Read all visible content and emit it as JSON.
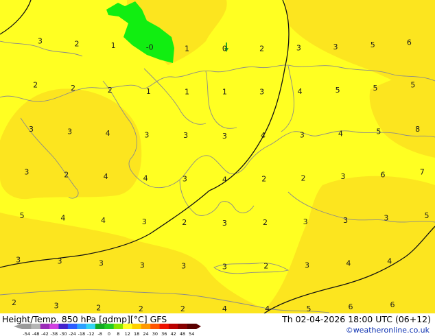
{
  "header": {
    "product_label": "Height/Temp. 850 hPa [gdmp][°C] GFS",
    "valid_time": "Th 02-04-2026 18:00 UTC (06+12)",
    "credit": "©weatheronline.co.uk"
  },
  "legend": {
    "ticks": [
      "-54",
      "-48",
      "-42",
      "-38",
      "-30",
      "-24",
      "-18",
      "-12",
      "-8",
      "0",
      "8",
      "12",
      "18",
      "24",
      "30",
      "36",
      "42",
      "48",
      "54"
    ],
    "colors": [
      "#9a9a9a",
      "#b5b5b5",
      "#9c2cb8",
      "#d040e0",
      "#4422cc",
      "#2a5cff",
      "#2aa0ff",
      "#33d4f0",
      "#11aa22",
      "#22cc22",
      "#8ae600",
      "#ffff22",
      "#ffd000",
      "#ff9900",
      "#ff5500",
      "#ee1100",
      "#bb0000",
      "#880000",
      "#5a0000"
    ]
  },
  "map": {
    "fill_colors": {
      "yellow": "#ffff22",
      "gold": "#fce51f",
      "green": "#11ee11"
    },
    "labels": [
      {
        "text": "3",
        "lon": 0.076,
        "lat": 0.07
      },
      {
        "text": "2",
        "lon": 0.164,
        "lat": 0.08
      },
      {
        "text": "1",
        "lon": 0.251,
        "lat": 0.086
      },
      {
        "text": "-0",
        "lon": 0.338,
        "lat": 0.092
      },
      {
        "text": "1",
        "lon": 0.427,
        "lat": 0.096
      },
      {
        "text": "0",
        "lon": 0.517,
        "lat": 0.096
      },
      {
        "text": "2",
        "lon": 0.606,
        "lat": 0.096
      },
      {
        "text": "3",
        "lon": 0.694,
        "lat": 0.094
      },
      {
        "text": "3",
        "lon": 0.782,
        "lat": 0.09
      },
      {
        "text": "5",
        "lon": 0.871,
        "lat": 0.083
      },
      {
        "text": "6",
        "lon": 0.958,
        "lat": 0.075
      },
      {
        "text": "2",
        "lon": 0.065,
        "lat": 0.223
      },
      {
        "text": "2",
        "lon": 0.155,
        "lat": 0.233
      },
      {
        "text": "2",
        "lon": 0.243,
        "lat": 0.24
      },
      {
        "text": "1",
        "lon": 0.335,
        "lat": 0.245
      },
      {
        "text": "1",
        "lon": 0.427,
        "lat": 0.247
      },
      {
        "text": "1",
        "lon": 0.517,
        "lat": 0.247
      },
      {
        "text": "3",
        "lon": 0.606,
        "lat": 0.247
      },
      {
        "text": "4",
        "lon": 0.697,
        "lat": 0.245
      },
      {
        "text": "5",
        "lon": 0.787,
        "lat": 0.24
      },
      {
        "text": "5",
        "lon": 0.877,
        "lat": 0.233
      },
      {
        "text": "5",
        "lon": 0.967,
        "lat": 0.223
      },
      {
        "text": "3",
        "lon": 0.055,
        "lat": 0.376
      },
      {
        "text": "3",
        "lon": 0.147,
        "lat": 0.385
      },
      {
        "text": "4",
        "lon": 0.238,
        "lat": 0.39
      },
      {
        "text": "3",
        "lon": 0.331,
        "lat": 0.396
      },
      {
        "text": "3",
        "lon": 0.424,
        "lat": 0.398
      },
      {
        "text": "3",
        "lon": 0.517,
        "lat": 0.4
      },
      {
        "text": "4",
        "lon": 0.609,
        "lat": 0.398
      },
      {
        "text": "3",
        "lon": 0.702,
        "lat": 0.396
      },
      {
        "text": "4",
        "lon": 0.794,
        "lat": 0.392
      },
      {
        "text": "5",
        "lon": 0.885,
        "lat": 0.385
      },
      {
        "text": "8",
        "lon": 0.978,
        "lat": 0.376
      },
      {
        "text": "3",
        "lon": 0.044,
        "lat": 0.525
      },
      {
        "text": "2",
        "lon": 0.139,
        "lat": 0.534
      },
      {
        "text": "4",
        "lon": 0.233,
        "lat": 0.541
      },
      {
        "text": "4",
        "lon": 0.328,
        "lat": 0.547
      },
      {
        "text": "3",
        "lon": 0.422,
        "lat": 0.549
      },
      {
        "text": "4",
        "lon": 0.517,
        "lat": 0.551
      },
      {
        "text": "2",
        "lon": 0.611,
        "lat": 0.549
      },
      {
        "text": "2",
        "lon": 0.705,
        "lat": 0.547
      },
      {
        "text": "3",
        "lon": 0.8,
        "lat": 0.541
      },
      {
        "text": "6",
        "lon": 0.895,
        "lat": 0.534
      },
      {
        "text": "7",
        "lon": 0.989,
        "lat": 0.525
      },
      {
        "text": "5",
        "lon": 0.033,
        "lat": 0.676
      },
      {
        "text": "4",
        "lon": 0.131,
        "lat": 0.685
      },
      {
        "text": "4",
        "lon": 0.227,
        "lat": 0.693
      },
      {
        "text": "3",
        "lon": 0.325,
        "lat": 0.698
      },
      {
        "text": "2",
        "lon": 0.421,
        "lat": 0.7
      },
      {
        "text": "3",
        "lon": 0.517,
        "lat": 0.702
      },
      {
        "text": "2",
        "lon": 0.614,
        "lat": 0.7
      },
      {
        "text": "3",
        "lon": 0.71,
        "lat": 0.698
      },
      {
        "text": "3",
        "lon": 0.806,
        "lat": 0.693
      },
      {
        "text": "3",
        "lon": 0.903,
        "lat": 0.685
      },
      {
        "text": "5",
        "lon": 1.0,
        "lat": 0.676
      },
      {
        "text": "3",
        "lon": 0.024,
        "lat": 0.83
      },
      {
        "text": "3",
        "lon": 0.123,
        "lat": 0.835
      },
      {
        "text": "3",
        "lon": 0.222,
        "lat": 0.842
      },
      {
        "text": "3",
        "lon": 0.32,
        "lat": 0.849
      },
      {
        "text": "3",
        "lon": 0.419,
        "lat": 0.851
      },
      {
        "text": "3",
        "lon": 0.517,
        "lat": 0.853
      },
      {
        "text": "2",
        "lon": 0.616,
        "lat": 0.851
      },
      {
        "text": "3",
        "lon": 0.714,
        "lat": 0.849
      },
      {
        "text": "4",
        "lon": 0.813,
        "lat": 0.842
      },
      {
        "text": "4",
        "lon": 0.911,
        "lat": 0.835
      },
      {
        "text": "2",
        "lon": 0.014,
        "lat": 0.978
      },
      {
        "text": "3",
        "lon": 0.115,
        "lat": 0.989
      },
      {
        "text": "2",
        "lon": 0.216,
        "lat": 0.996
      },
      {
        "text": "2",
        "lon": 0.317,
        "lat": 1.0
      },
      {
        "text": "2",
        "lon": 0.417,
        "lat": 1.0
      },
      {
        "text": "4",
        "lon": 0.517,
        "lat": 1.0
      },
      {
        "text": "4",
        "lon": 0.619,
        "lat": 1.0
      },
      {
        "text": "5",
        "lon": 0.718,
        "lat": 1.0
      },
      {
        "text": "6",
        "lon": 0.818,
        "lat": 0.993
      },
      {
        "text": "6",
        "lon": 0.918,
        "lat": 0.986
      }
    ]
  }
}
